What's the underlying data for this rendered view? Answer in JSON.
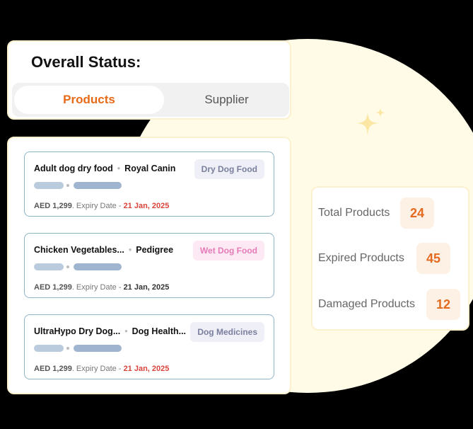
{
  "colors": {
    "accent": "#e76a18",
    "circle": "#fffbe6",
    "card_border": "#8fb4c8",
    "expiry_red": "#d9443b",
    "expiry_dark": "#333333"
  },
  "status": {
    "title": "Overall Status:",
    "tabs": [
      {
        "label": "Products",
        "active": true
      },
      {
        "label": "Supplier",
        "active": false
      }
    ]
  },
  "products": [
    {
      "name": "Adult dog dry food",
      "brand": "Royal Canin",
      "tag": "Dry Dog Food",
      "tag_bg": "#efeff7",
      "tag_color": "#7a7f9e",
      "price": "AED 1,299",
      "expiry_label": ". Expiry Date - ",
      "expiry_date": "21 Jan, 2025",
      "expiry_color": "#d9443b"
    },
    {
      "name": "Chicken Vegetables...",
      "brand": "Pedigree",
      "tag": "Wet Dog Food",
      "tag_bg": "#fde9f3",
      "tag_color": "#e57bb8",
      "price": "AED 1,299",
      "expiry_label": ". Expiry Date - ",
      "expiry_date": "21 Jan, 2025",
      "expiry_color": "#333333"
    },
    {
      "name": "UltraHypo Dry Dog...",
      "brand": "Dog Health...",
      "tag": "Dog Medicines",
      "tag_bg": "#efeff7",
      "tag_color": "#7a7f9e",
      "price": "AED 1,299",
      "expiry_label": ". Expiry Date - ",
      "expiry_date": "21 Jan, 2025",
      "expiry_color": "#d9443b"
    }
  ],
  "stats": [
    {
      "label": "Total Products",
      "value": "24"
    },
    {
      "label": "Expired Products",
      "value": "45"
    },
    {
      "label": "Damaged Products",
      "value": "12"
    }
  ]
}
